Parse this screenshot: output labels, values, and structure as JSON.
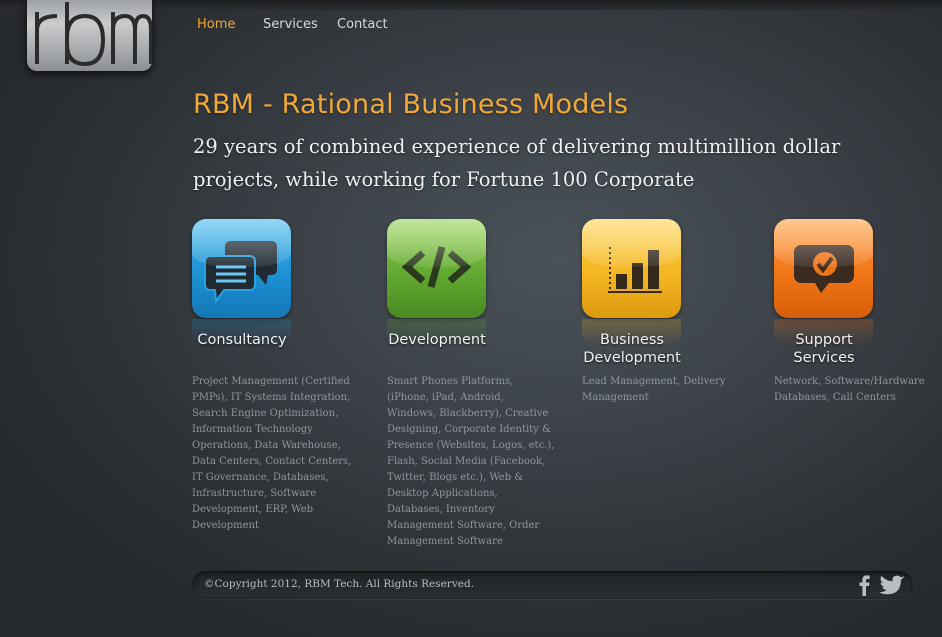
{
  "brand": {
    "logo_text": "rbm"
  },
  "nav": {
    "items": [
      {
        "label": "Home",
        "active": true
      },
      {
        "label": "Services"
      },
      {
        "label": "Contact"
      }
    ]
  },
  "hero": {
    "headline": "RBM - Rational Business Models",
    "tagline": "29 years of combined experience of delivering multimillion dollar projects, while working for Fortune 100 Corporate"
  },
  "services": [
    {
      "icon": "chat-bubbles-icon",
      "color": "#1f9ad8",
      "title_lines": [
        "Consultancy"
      ],
      "description": "Project Management (Certified PMPs), IT Systems Integration, Search Engine Optimization, Information Technology Operations, Data Warehouse, Data Centers, Contact Centers,  IT Governance, Databases, Infrastructure, Software Development, ERP, Web Development"
    },
    {
      "icon": "code-brackets-icon",
      "color": "#5fa630",
      "title_lines": [
        "Development"
      ],
      "description": "Smart Phones Platforms, (iPhone, iPad, Android, Windows, Blackberry), Creative Designing, Corporate Identity & Presence (Websites, Logos, etc.), Flash, Social Media (Facebook, Twitter, Blogs etc.), Web & Desktop Applications, Databases, Inventory Management Software, Order Management Software"
    },
    {
      "icon": "bar-chart-icon",
      "color": "#f2b320",
      "title_lines": [
        "Business",
        "Development"
      ],
      "description": "Lead Management, Delivery Management"
    },
    {
      "icon": "checkmark-bubble-icon",
      "color": "#ef7416",
      "title_lines": [
        "Support",
        "Services"
      ],
      "description": "Network, Software/Hardware Databases, Call Centers"
    }
  ],
  "footer": {
    "copyright": "©Copyright 2012, RBM Tech. All Rights Reserved.",
    "social": [
      {
        "icon": "facebook-icon"
      },
      {
        "icon": "twitter-icon"
      }
    ]
  }
}
